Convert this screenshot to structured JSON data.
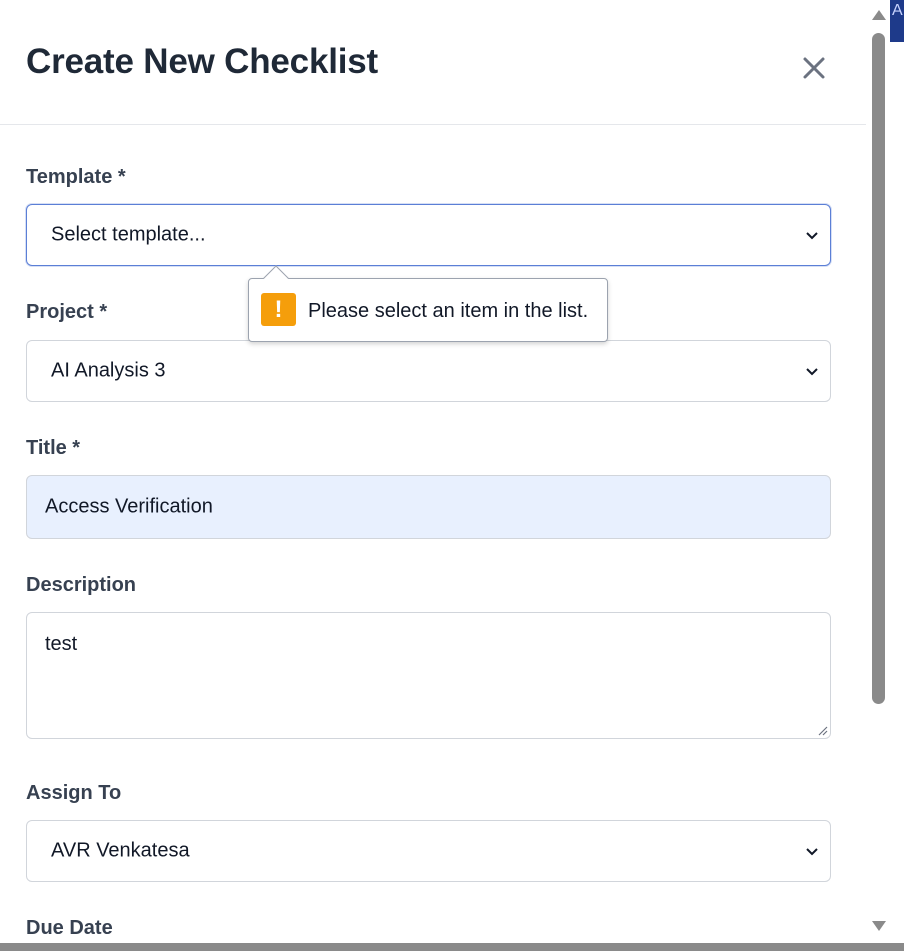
{
  "modal": {
    "title": "Create New Checklist"
  },
  "fields": {
    "template": {
      "label": "Template *",
      "value": "Select template..."
    },
    "project": {
      "label": "Project *",
      "value": "AI Analysis 3"
    },
    "title": {
      "label": "Title *",
      "value": "Access Verification"
    },
    "description": {
      "label": "Description",
      "value": "test"
    },
    "assign_to": {
      "label": "Assign To",
      "value": "AVR Venkatesa"
    },
    "due_date": {
      "label": "Due Date"
    }
  },
  "validation_tooltip": {
    "message": "Please select an item in the list."
  },
  "background": {
    "edge_text": "A"
  },
  "colors": {
    "focus_border": "#5b7fd6",
    "filled_field_bg": "#e8f0fe",
    "warning": "#f59e0b"
  }
}
